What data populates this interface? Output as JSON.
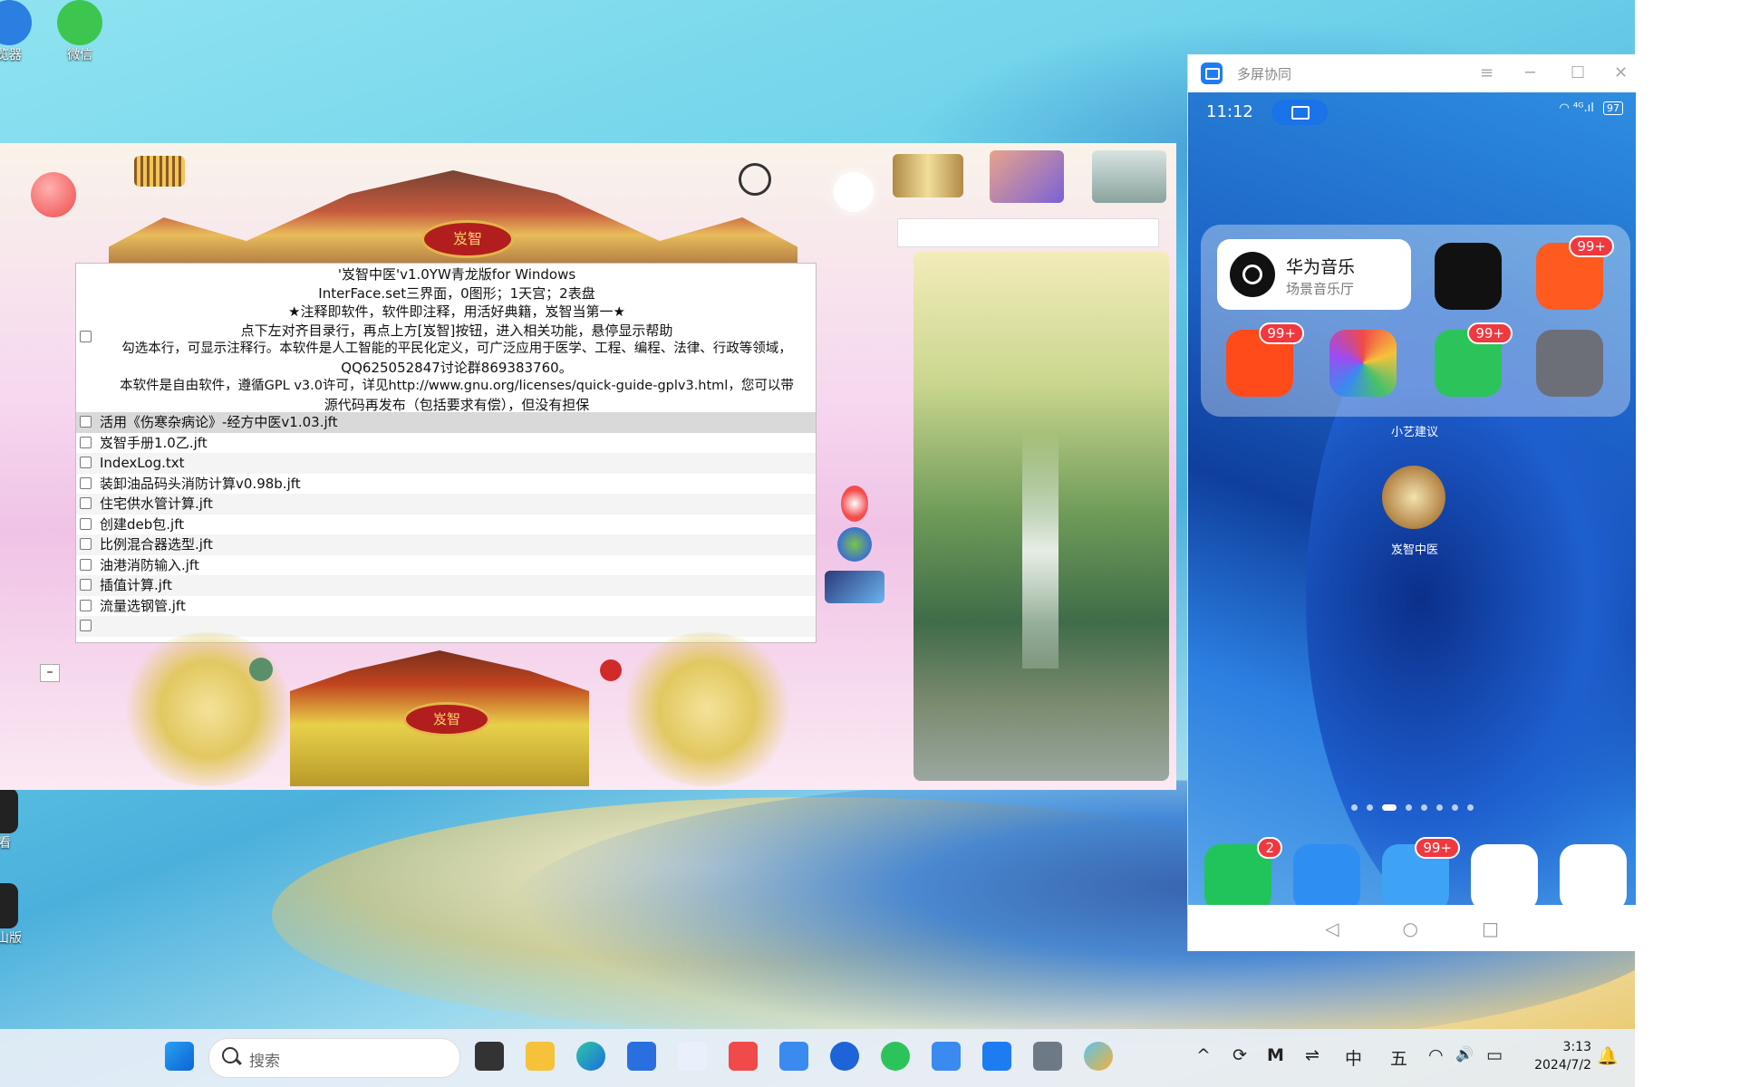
{
  "desktop": {
    "icons": [
      {
        "label": "览器"
      },
      {
        "label": "微信"
      },
      {
        "label": "看"
      },
      {
        "label": "山版"
      }
    ]
  },
  "app_window": {
    "plaque_top": "岌智",
    "plaque_bottom": "岌智",
    "minimize_label": "–",
    "header_lines": [
      "'岌智中医'v1.0YW青龙版for Windows",
      "InterFace.set三界面，0图形；1天宫；2表盘",
      "★注释即软件，软件即注释，用活好典籍，岌智当第一★",
      "点下左对齐目录行，再点上方[岌智]按钮，进入相关功能，悬停显示帮助",
      "勾选本行，可显示注释行。本软件是人工智能的平民化定义，可广泛应用于医学、工程、编程、法律、行政等领域，",
      "QQ625052847讨论群869383760。",
      "本软件是自由软件，遵循GPL v3.0许可，详见http://www.gnu.org/licenses/quick-guide-gplv3.html，您可以带",
      "源代码再发布（包括要求有偿），但没有担保"
    ],
    "files": [
      "活用《伤寒杂病论》-经方中医v1.03.jft",
      "岌智手册1.0乙.jft",
      "IndexLog.txt",
      "装卸油品码头消防计算v0.98b.jft",
      "住宅供水管计算.jft",
      "创建deb包.jft",
      "比例混合器选型.jft",
      "油港消防输入.jft",
      "插值计算.jft",
      "流量选钢管.jft",
      ""
    ]
  },
  "phone_window": {
    "title": "多屏协同",
    "controls": {
      "menu": "≡",
      "minimize": "─",
      "maximize": "☐",
      "close": "✕"
    },
    "status": {
      "time": "11:12",
      "signal": "⁴ᴳ.ıl",
      "battery": "97"
    },
    "music_card": {
      "title": "华为音乐",
      "subtitle": "场景音乐厅"
    },
    "apps": [
      {
        "badge": ""
      },
      {
        "badge": "99+"
      },
      {
        "badge": "99+"
      },
      {
        "badge": ""
      },
      {
        "badge": "99+"
      },
      {
        "badge": ""
      }
    ],
    "suggestion_label": "小艺建议",
    "app_label": "岌智中医",
    "dock": [
      {
        "badge": "2"
      },
      {
        "badge": ""
      },
      {
        "badge": "99+"
      },
      {
        "badge": ""
      },
      {
        "badge": ""
      }
    ],
    "nav": {
      "back": "◁",
      "home": "○",
      "recent": "□"
    }
  },
  "taskbar": {
    "search_placeholder": "搜索",
    "tray": {
      "chevron": "^",
      "ime_cn": "中",
      "ime_wubi": "五",
      "volume": "🔊"
    },
    "clock": {
      "time": "3:13",
      "date": "2024/7/2"
    }
  },
  "colors": {
    "accent": "#1e7cf2",
    "badge": "#f0383f"
  }
}
